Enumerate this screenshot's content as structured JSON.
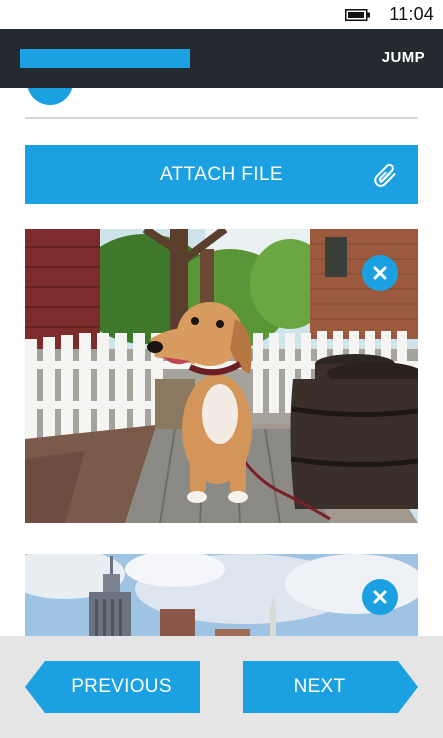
{
  "status_bar": {
    "time": "11:04",
    "battery_icon": "battery-icon"
  },
  "header": {
    "title": "",
    "title_color": "#1ba1e2",
    "background": "#252a31",
    "jump_label": "JUMP"
  },
  "main": {
    "attach_button_label": "ATTACH FILE",
    "attach_icon": "paperclip-icon",
    "accent": "#1ba1e2",
    "attachments": [
      {
        "kind": "image",
        "subject": "dog",
        "remove_icon": "close-icon"
      },
      {
        "kind": "image",
        "subject": "city-skyline",
        "remove_icon": "close-icon"
      }
    ]
  },
  "footer": {
    "previous_label": "PREVIOUS",
    "next_label": "NEXT"
  }
}
